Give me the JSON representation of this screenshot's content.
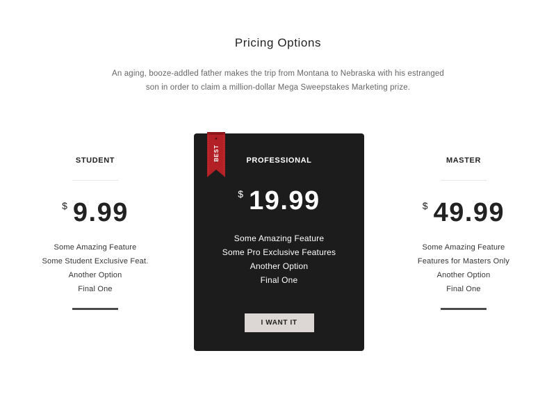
{
  "header": {
    "title": "Pricing Options",
    "description": "An aging, booze-addled father makes the trip from Montana to Nebraska with his estranged son in order to claim a million-dollar Mega Sweepstakes Marketing prize."
  },
  "plans": [
    {
      "name": "STUDENT",
      "currency": "$",
      "price": "9.99",
      "features": [
        "Some Amazing Feature",
        "Some Student Exclusive Feat.",
        "Another Option",
        "Final One"
      ]
    },
    {
      "name": "PROFESSIONAL",
      "currency": "$",
      "price": "19.99",
      "badge": "BEST",
      "features": [
        "Some Amazing Feature",
        "Some Pro Exclusive Features",
        "Another Option",
        "Final One"
      ],
      "cta_label": "I WANT IT"
    },
    {
      "name": "MASTER",
      "currency": "$",
      "price": "49.99",
      "features": [
        "Some Amazing Feature",
        "Features for Masters Only",
        "Another Option",
        "Final One"
      ]
    }
  ],
  "colors": {
    "featured_card_bg": "#1c1c1c",
    "ribbon": "#b32025",
    "cta_bg": "#dcd7d5",
    "accent_bar": "#4a4a4a"
  }
}
